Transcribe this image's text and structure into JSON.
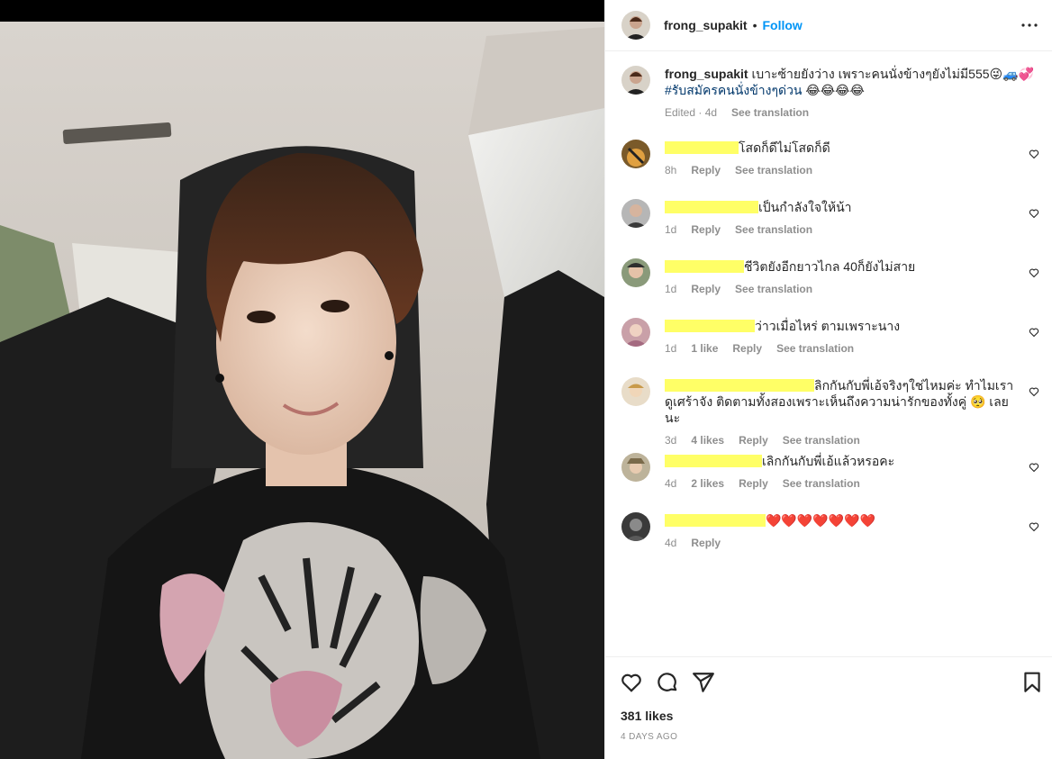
{
  "post": {
    "username": "frong_supakit",
    "follow_label": "Follow",
    "separator": "•",
    "more_icon": "more-horizontal-icon"
  },
  "caption": {
    "username": "frong_supakit",
    "text": "เบาะซ้ายยังว่าง เพราะคนนั่งข้างๆยังไม่มี555😜🚙💞",
    "hashtag": "#รับสมัครคนนั่งข้างๆด่วน",
    "emojis": " 😂😂😂😂",
    "meta": {
      "status": "Edited · 4d",
      "translate": "See translation"
    }
  },
  "comments": [
    {
      "text": "โสดก็ดีไม่โสดก็ดี",
      "time": "8h",
      "likes": "",
      "reply": "Reply",
      "translate": "See translation"
    },
    {
      "text": "เป็นกำลังใจให้น้า",
      "time": "1d",
      "likes": "",
      "reply": "Reply",
      "translate": "See translation"
    },
    {
      "text": "ชีวิตยังอีกยาวไกล 40ก็ยังไม่สาย",
      "time": "1d",
      "likes": "",
      "reply": "Reply",
      "translate": "See translation"
    },
    {
      "text": "ว่าวเมื่อไหร่ ตามเพราะนาง",
      "time": "1d",
      "likes": "1 like",
      "reply": "Reply",
      "translate": "See translation"
    },
    {
      "text": "ลิกกันกับพี่เอ้จริงๆใช่ไหมค่ะ ทำไมเราดูเศร้าจัง ติดตามทั้งสองเพราะเห็นถึงความน่ารักของทั้งคู่ 🥺 เลยนะ",
      "time": "3d",
      "likes": "4 likes",
      "reply": "Reply",
      "translate": "See translation"
    },
    {
      "text": "เลิกกันกับพี่เอ้แล้วหรอคะ",
      "time": "4d",
      "likes": "2 likes",
      "reply": "Reply",
      "translate": "See translation"
    },
    {
      "text": "❤️❤️❤️❤️❤️❤️❤️",
      "time": "4d",
      "likes": "",
      "reply": "Reply",
      "translate": ""
    }
  ],
  "footer": {
    "likes": "381 likes",
    "ago": "4 days ago",
    "icons": [
      "heart-icon",
      "comment-icon",
      "share-icon",
      "bookmark-icon"
    ]
  },
  "colors": {
    "accent": "#0095f6",
    "text": "#262626",
    "muted": "#8e8e8e",
    "hashtag": "#00376b",
    "redaction": "#ffff66"
  }
}
